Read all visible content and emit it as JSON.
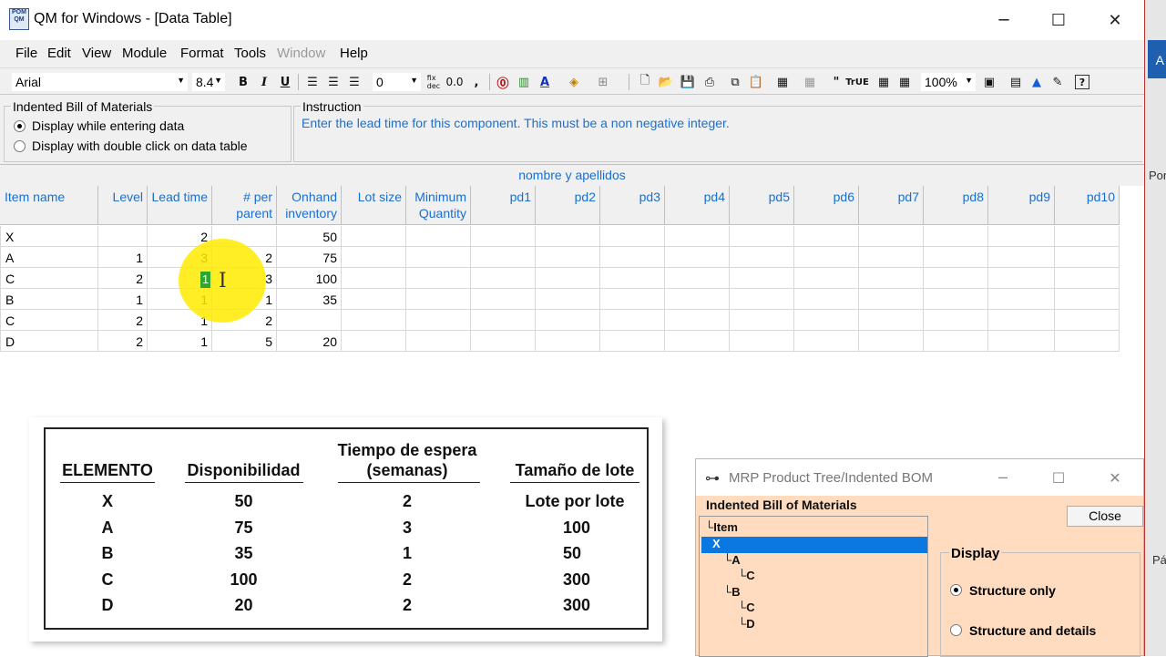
{
  "window": {
    "title": "QM for Windows - [Data Table]",
    "app_icon_text": "POM QM",
    "controls": {
      "minimize": "─",
      "maximize": "☐",
      "close": "✕"
    }
  },
  "menu": [
    "File",
    "Edit",
    "View",
    "Module",
    "Format",
    "Tools",
    "Window",
    "Help"
  ],
  "toolbar": {
    "font": "Arial",
    "font_size": "8.4",
    "decimals": "0",
    "fix_dec": "fix\ndec",
    "zero_zero": "0.0",
    "comma": ",",
    "zoom": "100%"
  },
  "options": {
    "group_title": "Indented Bill of Materials",
    "radio1": "Display while entering data",
    "radio2": "Display with double click on data table",
    "instruction_title": "Instruction",
    "instruction": "Enter the lead time for this component. This must be a non negative integer."
  },
  "grid": {
    "title": "nombre y apellidos",
    "headers": [
      "Item name",
      "Level",
      "Lead time",
      "# per\nparent",
      "Onhand\ninventory",
      "Lot size",
      "Minimum\nQuantity",
      "pd1",
      "pd2",
      "pd3",
      "pd4",
      "pd5",
      "pd6",
      "pd7",
      "pd8",
      "pd9",
      "pd10"
    ],
    "rows": [
      [
        "X",
        "",
        "2",
        "",
        "50"
      ],
      [
        "A",
        "1",
        "3",
        "2",
        "75"
      ],
      [
        "C",
        "2",
        "1",
        "3",
        "100"
      ],
      [
        "B",
        "1",
        "1",
        "1",
        "35"
      ],
      [
        "C",
        "2",
        "1",
        "2",
        ""
      ],
      [
        "D",
        "2",
        "1",
        "5",
        "20"
      ]
    ]
  },
  "bom_table": {
    "headers": [
      "ELEMENTO",
      "Disponibilidad",
      "Tiempo de espera",
      "(semanas)",
      "Tamaño de lote"
    ],
    "rows": [
      [
        "X",
        "50",
        "2",
        "Lote por lote"
      ],
      [
        "A",
        "75",
        "3",
        "100"
      ],
      [
        "B",
        "35",
        "1",
        "50"
      ],
      [
        "C",
        "100",
        "2",
        "300"
      ],
      [
        "D",
        "20",
        "2",
        "300"
      ]
    ]
  },
  "mrp_dialog": {
    "title": "MRP Product Tree/Indented BOM",
    "label": "Indented Bill of Materials",
    "tree": [
      "Item",
      "X",
      "A",
      "C",
      "B",
      "C",
      "D"
    ],
    "close": "Close",
    "display_title": "Display",
    "opt1": "Structure only",
    "opt2": "Structure and details"
  },
  "right_edge": {
    "t1": "A",
    "t2": "Por",
    "t3": "Pá"
  }
}
